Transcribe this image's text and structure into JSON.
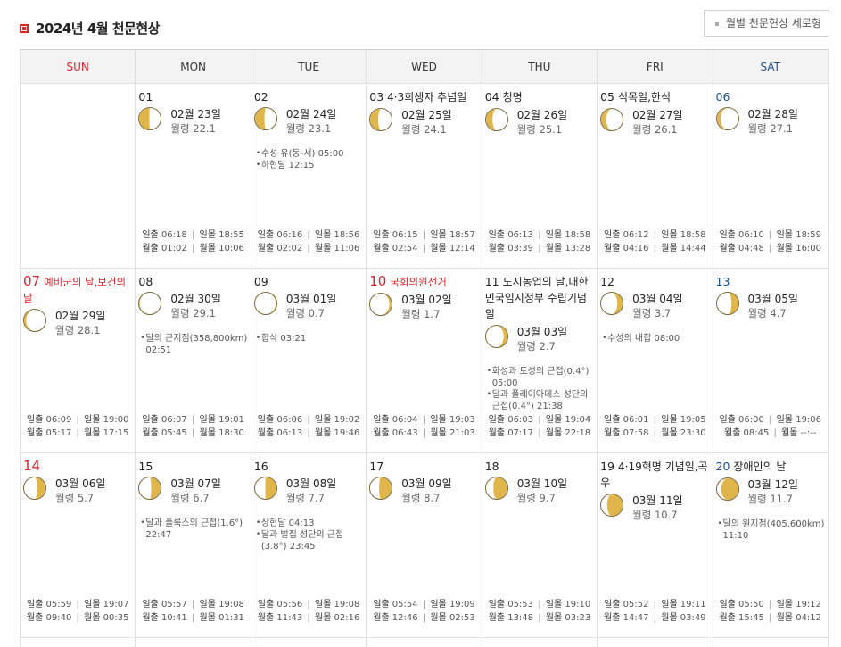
{
  "header": {
    "title": "2024년 4월 천문현상",
    "vertical_button_label": "월별 천문현상 세로형"
  },
  "weekdays": [
    "SUN",
    "MON",
    "TUE",
    "WED",
    "THU",
    "FRI",
    "SAT"
  ],
  "labels": {
    "sunrise": "일출",
    "sunset": "일몰",
    "moonrise": "월출",
    "moonset": "월몰",
    "age_prefix": "월령"
  },
  "weeks": [
    [
      null,
      {
        "day": "01",
        "holiday": "",
        "lunar": "02월 23일",
        "age": "22.1",
        "phase": 0.76,
        "events": [],
        "sunrise": "06:18",
        "sunset": "18:55",
        "moonrise": "01:02",
        "moonset": "10:06"
      },
      {
        "day": "02",
        "holiday": "",
        "lunar": "02월 24일",
        "age": "23.1",
        "phase": 0.78,
        "events": [
          "수성 유(동-서) 05:00",
          "하현달 12:15"
        ],
        "sunrise": "06:16",
        "sunset": "18:56",
        "moonrise": "02:02",
        "moonset": "11:06"
      },
      {
        "day": "03",
        "holiday": "4·3희생자 추념일",
        "lunar": "02월 25일",
        "age": "24.1",
        "phase": 0.81,
        "events": [],
        "sunrise": "06:15",
        "sunset": "18:57",
        "moonrise": "02:54",
        "moonset": "12:14"
      },
      {
        "day": "04",
        "holiday": "청명",
        "lunar": "02월 26일",
        "age": "25.1",
        "phase": 0.85,
        "events": [],
        "sunrise": "06:13",
        "sunset": "18:58",
        "moonrise": "03:39",
        "moonset": "13:28"
      },
      {
        "day": "05",
        "holiday": "식목일,한식",
        "lunar": "02월 27일",
        "age": "26.1",
        "phase": 0.88,
        "events": [],
        "sunrise": "06:12",
        "sunset": "18:58",
        "moonrise": "04:16",
        "moonset": "14:44"
      },
      {
        "day": "06",
        "holiday": "",
        "lunar": "02월 28일",
        "age": "27.1",
        "phase": 0.92,
        "events": [],
        "sunrise": "06:10",
        "sunset": "18:59",
        "moonrise": "04:48",
        "moonset": "16:00"
      }
    ],
    [
      {
        "day": "07",
        "holiday": "예비군의 날,보건의 날",
        "lunar": "02월 29일",
        "age": "28.1",
        "phase": 0.95,
        "events": [],
        "sunrise": "06:09",
        "sunset": "19:00",
        "moonrise": "05:17",
        "moonset": "17:15"
      },
      {
        "day": "08",
        "holiday": "",
        "lunar": "02월 30일",
        "age": "29.1",
        "phase": 0.985,
        "events": [
          "달의 근지점(358,800km) 02:51"
        ],
        "sunrise": "06:07",
        "sunset": "19:01",
        "moonrise": "05:45",
        "moonset": "18:30"
      },
      {
        "day": "09",
        "holiday": "",
        "lunar": "03월 01일",
        "age": "0.7",
        "phase": 0.02,
        "events": [
          "합삭 03:21"
        ],
        "sunrise": "06:06",
        "sunset": "19:02",
        "moonrise": "06:13",
        "moonset": "19:46"
      },
      {
        "day": "10",
        "holiday": "국회의원선거",
        "lunar": "03월 02일",
        "age": "1.7",
        "phase": 0.05,
        "events": [],
        "sunrise": "06:04",
        "sunset": "19:03",
        "moonrise": "06:43",
        "moonset": "21:03"
      },
      {
        "day": "11",
        "holiday": "도시농업의 날,대한민국임시정부 수립기념일",
        "lunar": "03월 03일",
        "age": "2.7",
        "phase": 0.09,
        "events": [
          "화성과 토성의 근접(0.4°) 05:00",
          "달과 플레이아데스 성단의 근접(0.4°) 21:38"
        ],
        "sunrise": "06:03",
        "sunset": "19:04",
        "moonrise": "07:17",
        "moonset": "22:18"
      },
      {
        "day": "12",
        "holiday": "",
        "lunar": "03월 04일",
        "age": "3.7",
        "phase": 0.12,
        "events": [
          "수성의 내합 08:00"
        ],
        "sunrise": "06:01",
        "sunset": "19:05",
        "moonrise": "07:58",
        "moonset": "23:30"
      },
      {
        "day": "13",
        "holiday": "",
        "lunar": "03월 05일",
        "age": "4.7",
        "phase": 0.16,
        "events": [],
        "sunrise": "06:00",
        "sunset": "19:06",
        "moonrise": "08:45",
        "moonset": "--:--"
      }
    ],
    [
      {
        "day": "14",
        "holiday": "",
        "lunar": "03월 06일",
        "age": "5.7",
        "phase": 0.19,
        "events": [],
        "sunrise": "05:59",
        "sunset": "19:07",
        "moonrise": "09:40",
        "moonset": "00:35"
      },
      {
        "day": "15",
        "holiday": "",
        "lunar": "03월 07일",
        "age": "6.7",
        "phase": 0.22,
        "events": [
          "달과 폴룩스의 근접(1.6°) 22:47"
        ],
        "sunrise": "05:57",
        "sunset": "19:08",
        "moonrise": "10:41",
        "moonset": "01:31"
      },
      {
        "day": "16",
        "holiday": "",
        "lunar": "03월 08일",
        "age": "7.7",
        "phase": 0.26,
        "events": [
          "상현달 04:13",
          "달과 벌집 성단의 근접(3.8°) 23:45"
        ],
        "sunrise": "05:56",
        "sunset": "19:08",
        "moonrise": "11:43",
        "moonset": "02:16"
      },
      {
        "day": "17",
        "holiday": "",
        "lunar": "03월 09일",
        "age": "8.7",
        "phase": 0.29,
        "events": [],
        "sunrise": "05:54",
        "sunset": "19:09",
        "moonrise": "12:46",
        "moonset": "02:53"
      },
      {
        "day": "18",
        "holiday": "",
        "lunar": "03월 10일",
        "age": "9.7",
        "phase": 0.33,
        "events": [],
        "sunrise": "05:53",
        "sunset": "19:10",
        "moonrise": "13:48",
        "moonset": "03:23"
      },
      {
        "day": "19",
        "holiday": "4·19혁명 기념일,곡우",
        "lunar": "03월 11일",
        "age": "10.7",
        "phase": 0.36,
        "events": [],
        "sunrise": "05:52",
        "sunset": "19:11",
        "moonrise": "14:47",
        "moonset": "03:49"
      },
      {
        "day": "20",
        "holiday": "장애인의 날",
        "lunar": "03월 12일",
        "age": "11.7",
        "phase": 0.4,
        "events": [
          "달의 원지점(405,600km) 11:10"
        ],
        "sunrise": "05:50",
        "sunset": "19:12",
        "moonrise": "15:45",
        "moonset": "04:12"
      }
    ]
  ],
  "colors": {
    "red": "#d9262c",
    "blue": "#1f4f8f",
    "moon_lit": "#e0b64a",
    "moon_edge": "#7a6a3a"
  }
}
